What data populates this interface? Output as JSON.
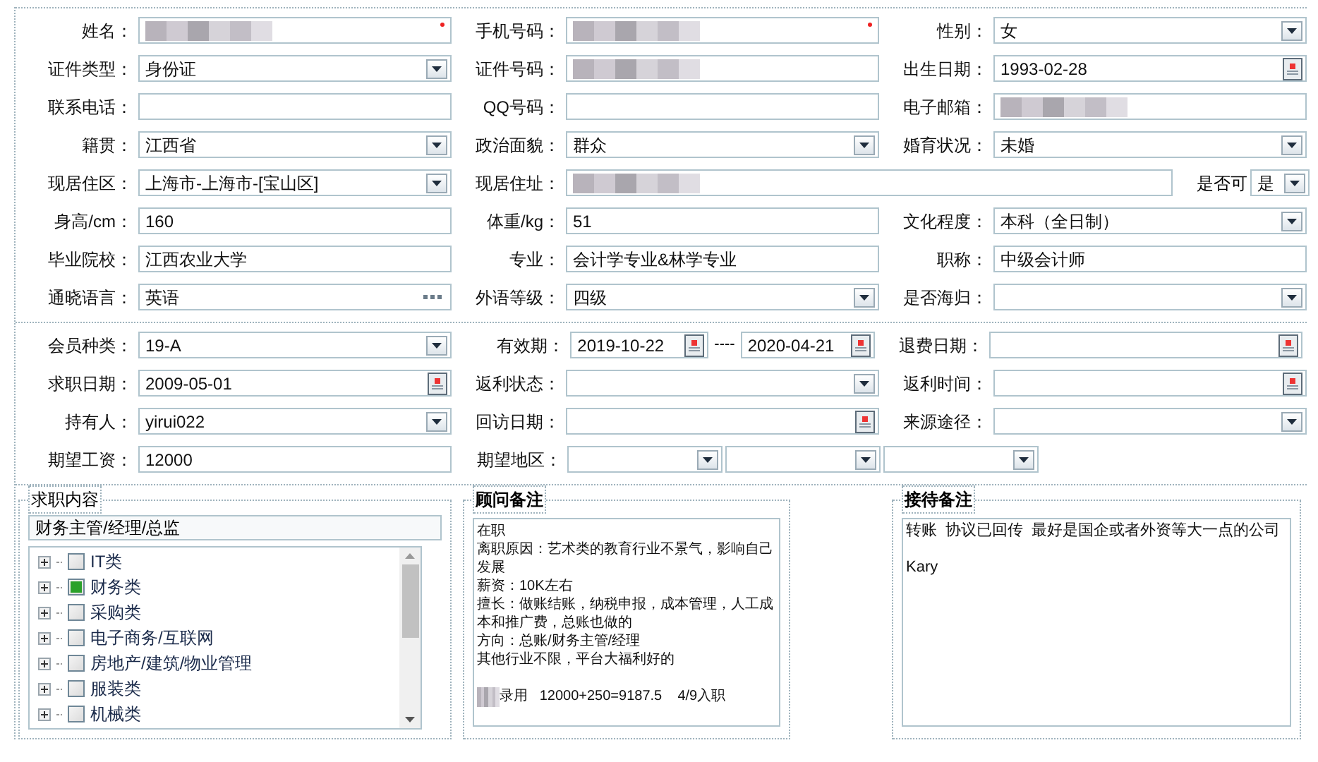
{
  "personal": {
    "rows": [
      [
        {
          "label": "姓名：",
          "kind": "text",
          "blurred": true,
          "required": true
        },
        {
          "label": "手机号码：",
          "kind": "text",
          "blurred": true,
          "required": true
        },
        {
          "label": "性别：",
          "kind": "select",
          "value": "女"
        }
      ],
      [
        {
          "label": "证件类型：",
          "kind": "select",
          "value": "身份证"
        },
        {
          "label": "证件号码：",
          "kind": "text",
          "blurred": true
        },
        {
          "label": "出生日期：",
          "kind": "date",
          "value": "1993-02-28"
        }
      ],
      [
        {
          "label": "联系电话：",
          "kind": "text"
        },
        {
          "label": "QQ号码：",
          "kind": "text"
        },
        {
          "label": "电子邮箱：",
          "kind": "text",
          "blurred": true
        }
      ],
      [
        {
          "label": "籍贯：",
          "kind": "select",
          "value": "江西省"
        },
        {
          "label": "政治面貌：",
          "kind": "select",
          "value": "群众"
        },
        {
          "label": "婚育状况：",
          "kind": "select",
          "value": "未婚"
        }
      ],
      [
        {
          "label": "现居住区：",
          "kind": "select",
          "value": "上海市-上海市-[宝山区]"
        },
        {
          "label": "现居住址：",
          "kind": "address",
          "blurred": true,
          "option_label": "是否可",
          "option_value": "是"
        }
      ],
      [
        {
          "label": "身高/cm：",
          "kind": "text",
          "value": "160"
        },
        {
          "label": "体重/kg：",
          "kind": "text",
          "value": "51"
        },
        {
          "label": "文化程度：",
          "kind": "select",
          "value": "本科（全日制）"
        }
      ],
      [
        {
          "label": "毕业院校：",
          "kind": "text",
          "value": "江西农业大学"
        },
        {
          "label": "专业：",
          "kind": "text",
          "value": "会计学专业&林学专业"
        },
        {
          "label": "职称：",
          "kind": "text",
          "value": "中级会计师"
        }
      ],
      [
        {
          "label": "通晓语言：",
          "kind": "lookup",
          "value": "英语"
        },
        {
          "label": "外语等级：",
          "kind": "select",
          "value": "四级"
        },
        {
          "label": "是否海归：",
          "kind": "select"
        }
      ]
    ]
  },
  "membership": {
    "rows": [
      [
        {
          "label": "会员种类：",
          "kind": "select",
          "value": "19-A"
        },
        {
          "label": "有效期：",
          "kind": "date-range",
          "value": "2019-10-22",
          "value_to": "2020-04-21",
          "separator": "----"
        },
        {
          "label": "退费日期：",
          "kind": "date"
        }
      ],
      [
        {
          "label": "求职日期：",
          "kind": "date",
          "value": "2009-05-01"
        },
        {
          "label": "返利状态：",
          "kind": "select"
        },
        {
          "label": "返利时间：",
          "kind": "date"
        }
      ],
      [
        {
          "label": "持有人：",
          "kind": "select",
          "value": "yirui022"
        },
        {
          "label": "回访日期：",
          "kind": "date"
        },
        {
          "label": "来源途径：",
          "kind": "select"
        }
      ],
      [
        {
          "label": "期望工资：",
          "kind": "text",
          "value": "12000"
        },
        {
          "label": "期望地区：",
          "kind": "triple-select"
        }
      ]
    ]
  },
  "job_panel": {
    "title": "求职内容",
    "selection": "财务主管/经理/总监",
    "tree": [
      {
        "label": "IT类",
        "checked": false
      },
      {
        "label": "财务类",
        "checked": true
      },
      {
        "label": "采购类",
        "checked": false
      },
      {
        "label": "电子商务/互联网",
        "checked": false
      },
      {
        "label": "房地产/建筑/物业管理",
        "checked": false
      },
      {
        "label": "服装类",
        "checked": false
      },
      {
        "label": "机械类",
        "checked": false
      }
    ]
  },
  "advisor_notes": {
    "title": "顾问备注",
    "lines": [
      {
        "text": "在职"
      },
      {
        "text": "离职原因：艺术类的教育行业不景气，影响自己发展"
      },
      {
        "text": "薪资：10K左右"
      },
      {
        "text": "擅长：做账结账，纳税申报，成本管理，人工成本和推广费，总账也做的"
      },
      {
        "text": "方向：总账/财务主管/经理"
      },
      {
        "text": "其他行业不限，平台大福利好的"
      },
      {
        "text": "录用   12000+250=9187.5    4/9入职",
        "redacted_prefix": true,
        "spaced": true
      }
    ]
  },
  "reception_notes": {
    "title": "接待备注",
    "lines": [
      {
        "text": "转账  协议已回传  最好是国企或者外资等大一点的公司"
      },
      {
        "text": "Kary",
        "spaced": true
      }
    ]
  }
}
